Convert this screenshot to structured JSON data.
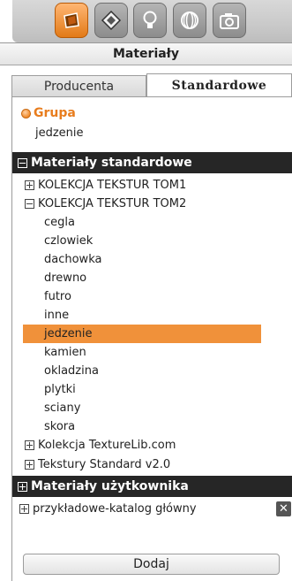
{
  "panel": {
    "title": "Materiały"
  },
  "toolbar": {
    "buttons": [
      {
        "icon": "material-icon",
        "active": true
      },
      {
        "icon": "texture-icon",
        "active": false
      },
      {
        "icon": "light-bulb-icon",
        "active": false
      },
      {
        "icon": "sphere-icon",
        "active": false
      },
      {
        "icon": "camera-icon",
        "active": false
      }
    ]
  },
  "tabs": [
    {
      "label": "Producenta",
      "active": false
    },
    {
      "label": "Standardowe",
      "active": true
    }
  ],
  "group": {
    "label": "Grupa",
    "value": "jedzenie"
  },
  "standard_section": {
    "label": "Materiały standardowe",
    "expanded": true
  },
  "collections": {
    "tom1": {
      "label": "KOLEKCJA TEKSTUR TOM1",
      "expanded": false
    },
    "tom2": {
      "label": "KOLEKCJA TEKSTUR TOM2",
      "expanded": true,
      "items": [
        "cegla",
        "czlowiek",
        "dachowka",
        "drewno",
        "futro",
        "inne",
        "jedzenie",
        "kamien",
        "okladzina",
        "plytki",
        "sciany",
        "skora"
      ],
      "selected": "jedzenie"
    },
    "texturelib": {
      "label": "Kolekcja TextureLib.com",
      "expanded": false
    },
    "standard_v2": {
      "label": "Tekstury Standard v2.0",
      "expanded": false
    }
  },
  "user_section": {
    "label": "Materiały użytkownika",
    "expanded": false
  },
  "user_catalog": {
    "label": "przykładowe-katalog główny",
    "close_glyph": "✕"
  },
  "add_button": {
    "label": "Dodaj"
  },
  "colors": {
    "accent": "#f0913a",
    "header": "#262626",
    "group_label": "#e87d1e"
  }
}
